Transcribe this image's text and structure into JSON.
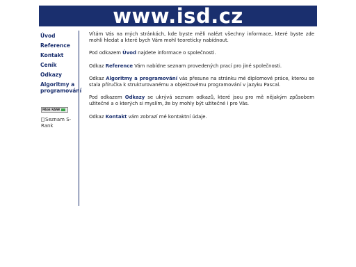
{
  "banner": {
    "title": "www.isd.cz"
  },
  "nav": {
    "items": [
      {
        "label": "Úvod"
      },
      {
        "label": "Reference"
      },
      {
        "label": "Kontakt"
      },
      {
        "label": "Ceník"
      },
      {
        "label": "Odkazy"
      },
      {
        "label": "Algoritmy a programování"
      }
    ]
  },
  "sidebar": {
    "badge_label": "PAGE RANK",
    "seznam_alt": "Seznam S-Rank"
  },
  "content": {
    "p1": "Vítám Vás na mých stránkách, kde byste měli nalézt všechny informace, které byste zde mohli hledat a které bych Vám mohl teoreticky nabídnout.",
    "p2": {
      "before": "Pod odkazem ",
      "link": "Úvod",
      "after": " najdete informace o společnosti."
    },
    "p3": {
      "before": "Odkaz ",
      "link": "Reference",
      "after": " Vám nabídne seznam provedených prací pro jiné společnosti."
    },
    "p4": {
      "before": "Odkaz ",
      "link": "Algoritmy a programování",
      "after": " vás přesune na stránku mé diplomové práce, kterou se stala příručka k strukturovanému a objektovému programování v jazyku Pascal."
    },
    "p5": {
      "before": "Pod odkazem ",
      "link": "Odkazy",
      "after": " se ukrývá seznam odkazů, které jsou pro mě nějakým způsobem užitečné a o kterých si myslím, že by mohly být užitečné i pro Vás."
    },
    "p6": {
      "before": "Odkaz ",
      "link": "Kontakt",
      "after": " vám zobrazí mé kontaktní údaje."
    }
  },
  "colors": {
    "brand": "#1a2f6e",
    "text": "#1a1a1a",
    "background": "#ffffff"
  }
}
